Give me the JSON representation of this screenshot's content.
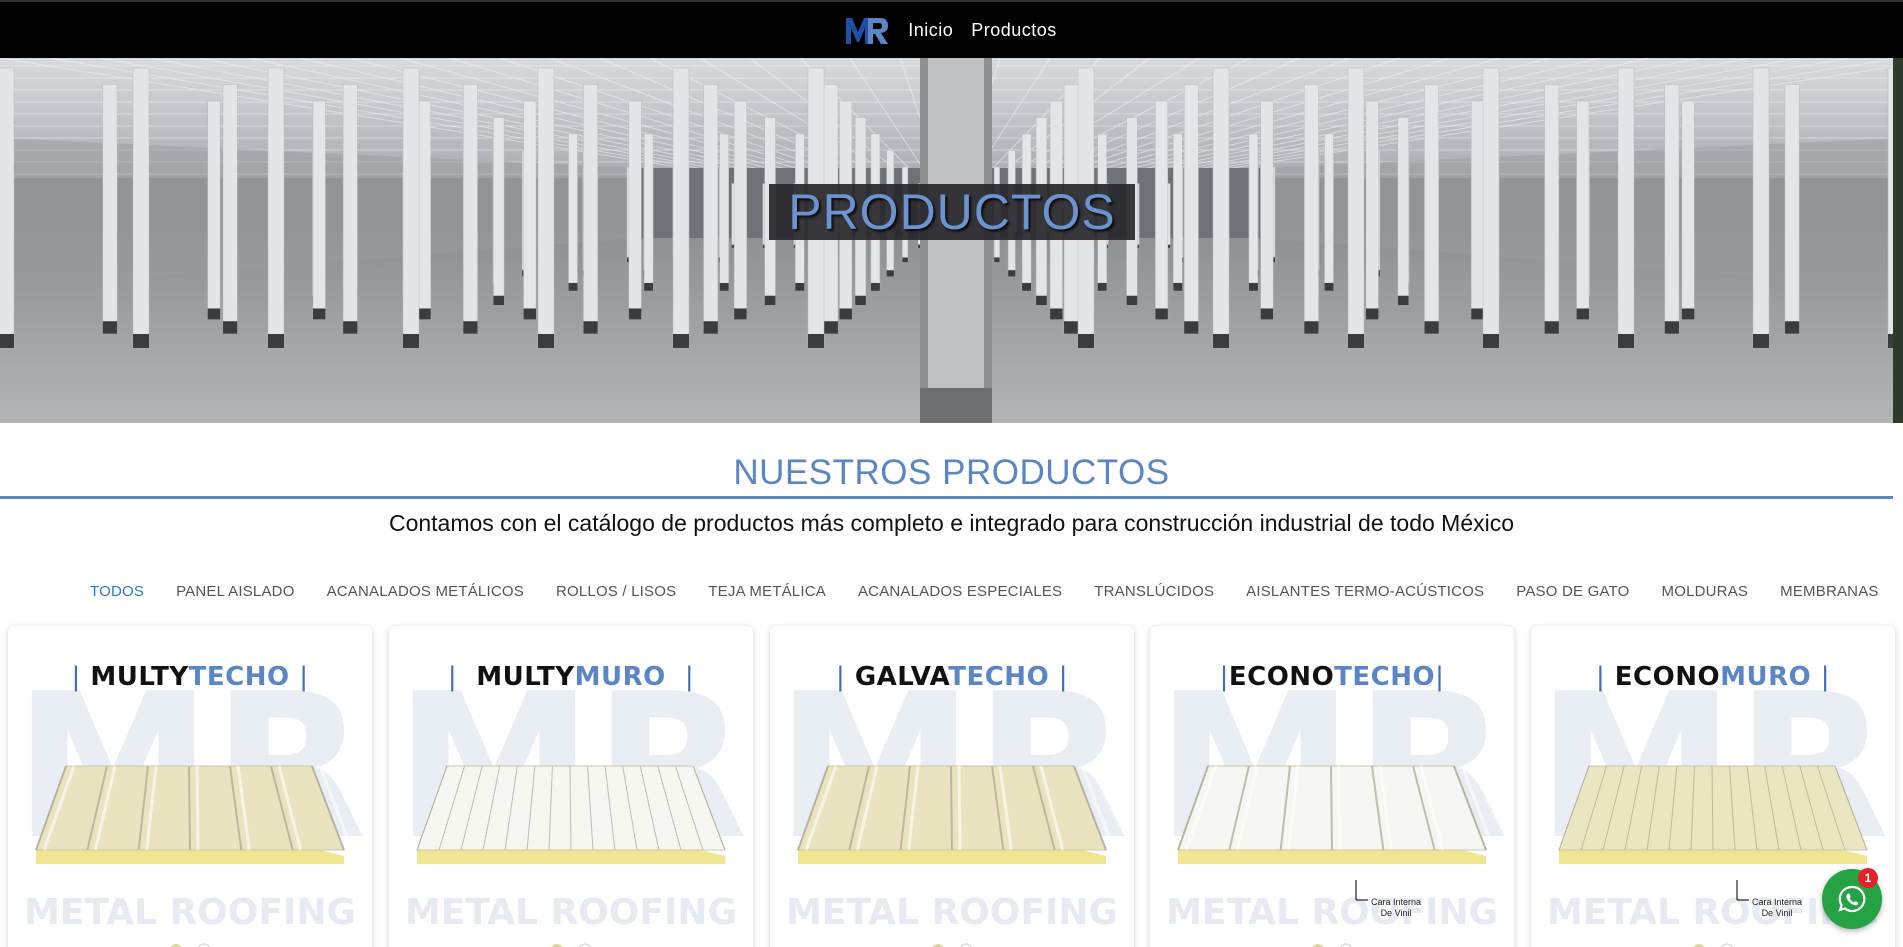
{
  "nav": {
    "logo_text": "MR",
    "links": [
      {
        "label": "Inicio"
      },
      {
        "label": "Productos"
      }
    ]
  },
  "hero": {
    "title": "PRODUCTOS"
  },
  "section": {
    "title": "NUESTROS PRODUCTOS",
    "subtitle": "Contamos con el catálogo de productos más completo e integrado para construcción industrial de todo México"
  },
  "filters": [
    {
      "label": "TODOS",
      "active": true
    },
    {
      "label": "PANEL AISLADO",
      "active": false
    },
    {
      "label": "ACANALADOS METÁLICOS",
      "active": false
    },
    {
      "label": "ROLLOS / LISOS",
      "active": false
    },
    {
      "label": "TEJA METÁLICA",
      "active": false
    },
    {
      "label": "ACANALADOS ESPECIALES",
      "active": false
    },
    {
      "label": "TRANSLÚCIDOS",
      "active": false
    },
    {
      "label": "AISLANTES TERMO-ACÚSTICOS",
      "active": false
    },
    {
      "label": "PASO DE GATO",
      "active": false
    },
    {
      "label": "MOLDURAS",
      "active": false
    },
    {
      "label": "MEMBRANAS",
      "active": false
    }
  ],
  "products": [
    {
      "word1": "MULTY",
      "word2": "TECHO",
      "watermark": "METAL ROOFING",
      "panel_color": "#e9e4bf",
      "note": ""
    },
    {
      "word1": "MULTY",
      "word2": "MURO",
      "watermark": "METAL ROOFING",
      "panel_color": "#f6f6f2",
      "note": ""
    },
    {
      "word1": "GALVA",
      "word2": "TECHO",
      "watermark": "METAL ROOFING",
      "panel_color": "#e9e4bf",
      "note": ""
    },
    {
      "word1": "ECONO",
      "word2": "TECHO",
      "watermark": "METAL ROOFING",
      "panel_color": "#f6f6f2",
      "note": "Cara Interna De Vinil"
    },
    {
      "word1": "ECONO",
      "word2": "MURO",
      "watermark": "METAL ROOFING",
      "panel_color": "#ebe6c2",
      "note": "Cara Interna De Vinil"
    }
  ],
  "whatsapp": {
    "badge_count": "1",
    "icon": "whatsapp-icon"
  },
  "colors": {
    "accent": "#5b86c5",
    "active_tab": "#2e79c7",
    "navbar": "#000000",
    "whatsapp": "#25a244",
    "badge": "#e4202b"
  }
}
